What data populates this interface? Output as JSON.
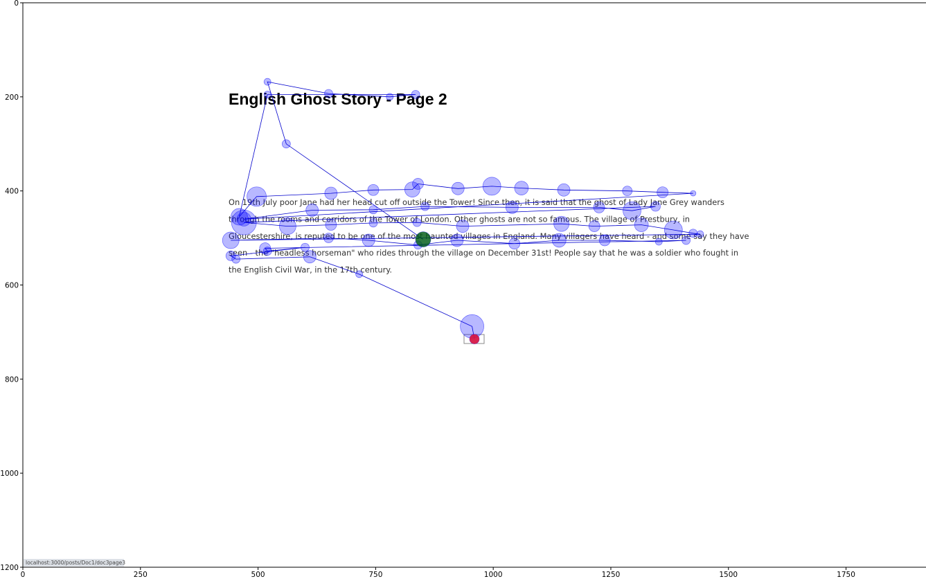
{
  "page": {
    "title": "English Ghost Story - Page 2",
    "paragraph_lines": [
      "On 19th July poor Jane had her head cut off outside the Tower! Since then, it is said that the ghost of Lady Jane Grey wanders",
      "through the rooms and corridors of the Tower of London. Other ghosts are not so famous. The village of Prestbury, in",
      "Gloucestershire, is reputed to be one of the most haunted villages in England. Many villagers have heard - and some say they have",
      "seen - the \"headless horseman\" who rides through the village on December 31st! People say that he was a soldier who fought in",
      "the English Civil War, in the 17th century."
    ],
    "url": "localhost:3000/posts/Doc1/doc3page3"
  },
  "chart_data": {
    "type": "scatter",
    "xlim": [
      0,
      1920
    ],
    "ylim": [
      1200,
      0
    ],
    "xticks": [
      "0",
      "250",
      "500",
      "750",
      "1000",
      "1250",
      "1500",
      "1750"
    ],
    "yticks": [
      "0",
      "200",
      "400",
      "600",
      "800",
      "1000",
      "1200"
    ],
    "grid": false,
    "colors": {
      "fixation": "#0000ff",
      "start": "#006400",
      "end": "#dc143c",
      "scanpath": "#0000cc"
    },
    "start": {
      "x": 851,
      "y": 503
    },
    "end": {
      "x": 960,
      "y": 715
    },
    "fixations": [
      {
        "x": 851,
        "y": 503
      },
      {
        "x": 560,
        "y": 300
      },
      {
        "x": 520,
        "y": 168
      },
      {
        "x": 650,
        "y": 193
      },
      {
        "x": 780,
        "y": 200
      },
      {
        "x": 835,
        "y": 195
      },
      {
        "x": 520,
        "y": 195
      },
      {
        "x": 460,
        "y": 455
      },
      {
        "x": 497,
        "y": 412
      },
      {
        "x": 655,
        "y": 405
      },
      {
        "x": 745,
        "y": 398
      },
      {
        "x": 828,
        "y": 397
      },
      {
        "x": 840,
        "y": 385
      },
      {
        "x": 925,
        "y": 395
      },
      {
        "x": 997,
        "y": 390
      },
      {
        "x": 1060,
        "y": 394
      },
      {
        "x": 1150,
        "y": 398
      },
      {
        "x": 1285,
        "y": 400
      },
      {
        "x": 1360,
        "y": 403
      },
      {
        "x": 1425,
        "y": 405
      },
      {
        "x": 470,
        "y": 460
      },
      {
        "x": 615,
        "y": 441
      },
      {
        "x": 745,
        "y": 440
      },
      {
        "x": 855,
        "y": 433
      },
      {
        "x": 1040,
        "y": 435
      },
      {
        "x": 1225,
        "y": 435
      },
      {
        "x": 1295,
        "y": 442
      },
      {
        "x": 1345,
        "y": 433
      },
      {
        "x": 470,
        "y": 467
      },
      {
        "x": 563,
        "y": 475
      },
      {
        "x": 655,
        "y": 472
      },
      {
        "x": 745,
        "y": 468
      },
      {
        "x": 838,
        "y": 467
      },
      {
        "x": 935,
        "y": 475
      },
      {
        "x": 1145,
        "y": 470
      },
      {
        "x": 1215,
        "y": 475
      },
      {
        "x": 1315,
        "y": 472
      },
      {
        "x": 1383,
        "y": 483
      },
      {
        "x": 1425,
        "y": 490
      },
      {
        "x": 1440,
        "y": 492
      },
      {
        "x": 442,
        "y": 505
      },
      {
        "x": 650,
        "y": 500
      },
      {
        "x": 735,
        "y": 505
      },
      {
        "x": 840,
        "y": 515
      },
      {
        "x": 923,
        "y": 505
      },
      {
        "x": 1045,
        "y": 512
      },
      {
        "x": 1140,
        "y": 505
      },
      {
        "x": 1237,
        "y": 505
      },
      {
        "x": 1352,
        "y": 508
      },
      {
        "x": 1410,
        "y": 505
      },
      {
        "x": 515,
        "y": 522
      },
      {
        "x": 520,
        "y": 528
      },
      {
        "x": 600,
        "y": 520
      },
      {
        "x": 442,
        "y": 538
      },
      {
        "x": 453,
        "y": 545
      },
      {
        "x": 610,
        "y": 540
      },
      {
        "x": 715,
        "y": 577
      },
      {
        "x": 955,
        "y": 688
      },
      {
        "x": 960,
        "y": 715
      }
    ]
  }
}
